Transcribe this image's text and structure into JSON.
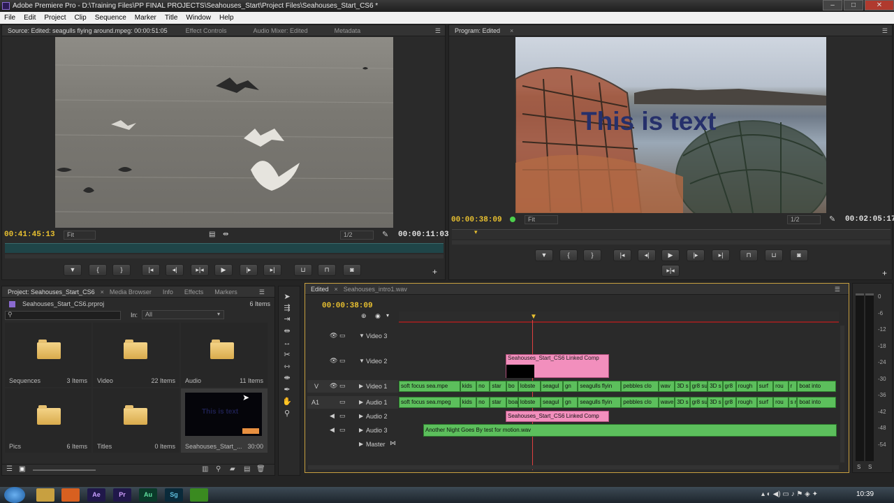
{
  "window": {
    "title": "Adobe Premiere Pro - D:\\Training Files\\PP FINAL PROJECTS\\Seahouses_Start\\Project Files\\Seahouses_Start_CS6 *",
    "min": "–",
    "max": "□",
    "close": "✕"
  },
  "menu": [
    "File",
    "Edit",
    "Project",
    "Clip",
    "Sequence",
    "Marker",
    "Title",
    "Window",
    "Help"
  ],
  "source_monitor": {
    "tabs": [
      "Source: Edited: seagulls flying around.mpeg: 00:00:51:05",
      "Effect Controls",
      "Audio Mixer: Edited",
      "Metadata"
    ],
    "timecode_in": "00:41:45:13",
    "fit": "Fit",
    "resolution": "1/2",
    "duration": "00:00:11:03"
  },
  "program_monitor": {
    "tab": "Program: Edited",
    "overlay_text": "This is text",
    "timecode": "00:00:38:09",
    "fit": "Fit",
    "resolution": "1/2",
    "duration": "00:02:05:17"
  },
  "project": {
    "tabs": [
      "Project: Seahouses_Start_CS6",
      "Media Browser",
      "Info",
      "Effects",
      "Markers"
    ],
    "file": "Seahouses_Start_CS6.prproj",
    "item_count": "6 Items",
    "search_placeholder": "",
    "in_label": "In:",
    "in_value": "All",
    "bins": [
      {
        "name": "Sequences",
        "count": "3 Items"
      },
      {
        "name": "Video",
        "count": "22 Items"
      },
      {
        "name": "Audio",
        "count": "11 Items"
      },
      {
        "name": "Pics",
        "count": "6 Items"
      },
      {
        "name": "Titles",
        "count": "0 Items"
      }
    ],
    "sequence_item": {
      "name": "Seahouses_Start_...",
      "duration": "30:00",
      "thumb_text": "This is text"
    }
  },
  "timeline": {
    "tabs": [
      "Edited",
      "Seahouses_intro1.wav"
    ],
    "timecode": "00:00:38:09",
    "tracks": [
      {
        "name": "Video 3"
      },
      {
        "name": "Video 2"
      },
      {
        "name": "Video 1",
        "label": "V"
      },
      {
        "name": "Audio 1",
        "label": "A1"
      },
      {
        "name": "Audio 2"
      },
      {
        "name": "Audio 3"
      },
      {
        "name": "Master"
      }
    ],
    "clips": {
      "video2": "Seahouses_Start_CS6 Linked Comp",
      "video1": [
        "soft focus sea.mpe",
        "kids",
        "no",
        "star",
        "bo",
        "lobste",
        "seagul",
        "gn",
        "seagulls flyin",
        "pebbles clo",
        "wav",
        "3D s",
        "gr8 su",
        "3D s",
        "gr8",
        "rough",
        "surf",
        "rou",
        "r",
        "boat into"
      ],
      "audio1": [
        "soft focus sea.mpeg",
        "kids",
        "no ",
        "star",
        "boa",
        "lobste",
        "seagul",
        "gn",
        "seagulls flyin",
        "pebbles clo",
        "wave",
        "3D s",
        "gr8 su",
        "3D s",
        "gr8",
        "rough",
        "surf",
        "rou",
        "s r",
        "boat into"
      ],
      "audio2": "Seahouses_Start_CS6 Linked Comp",
      "audio3": "Another Night Goes By test for motion.wav"
    }
  },
  "meter_scale": [
    "0",
    "-6",
    "-12",
    "-18",
    "-24",
    "-30",
    "-36",
    "-42",
    "-48",
    "-54"
  ],
  "meter_buttons": [
    "S",
    "S"
  ],
  "taskbar": {
    "clock": "10:39"
  },
  "colors": {
    "timecode": "#e8c030",
    "video_clip": "#5cbf5c",
    "linked_comp": "#f28fbd",
    "playhead": "#e04040"
  }
}
